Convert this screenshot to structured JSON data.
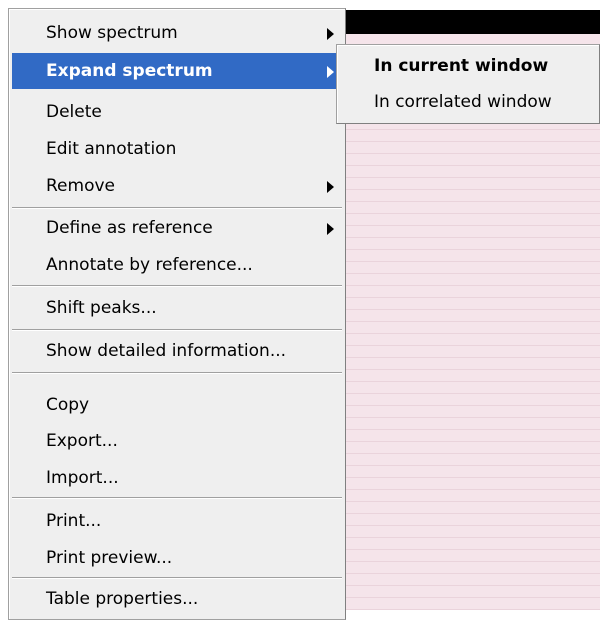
{
  "context_menu": {
    "items": [
      {
        "label": "Show spectrum",
        "has_submenu": true
      },
      {
        "label": "Expand spectrum",
        "has_submenu": true,
        "highlighted": true
      },
      {
        "label": "Delete"
      },
      {
        "label": "Edit annotation"
      },
      {
        "label": "Remove",
        "has_submenu": true
      },
      {
        "label": "Define as reference",
        "has_submenu": true
      },
      {
        "label": "Annotate by reference..."
      },
      {
        "label": "Shift peaks..."
      },
      {
        "label": "Show detailed information..."
      },
      {
        "label": "Copy"
      },
      {
        "label": "Export..."
      },
      {
        "label": "Import..."
      },
      {
        "label": "Print..."
      },
      {
        "label": "Print preview..."
      },
      {
        "label": "Table properties..."
      }
    ]
  },
  "submenu": {
    "items": [
      {
        "label": "In current window",
        "bold": true
      },
      {
        "label": "In correlated window"
      }
    ]
  },
  "colors": {
    "highlight": "#316ac5",
    "menu_bg": "#efefef",
    "table_bg": "#f5e4ea",
    "header_bg": "#000000"
  }
}
